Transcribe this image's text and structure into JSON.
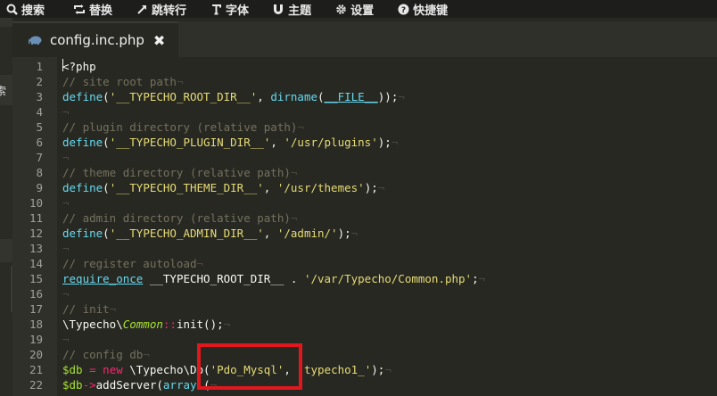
{
  "toolbar": {
    "items": [
      {
        "label": "搜索",
        "icon": "search-icon"
      },
      {
        "label": "替换",
        "icon": "replace-icon"
      },
      {
        "label": "跳转行",
        "icon": "goto-line-icon"
      },
      {
        "label": "字体",
        "icon": "font-icon"
      },
      {
        "label": "主题",
        "icon": "magnet-icon"
      },
      {
        "label": "设置",
        "icon": "gear-icon"
      },
      {
        "label": "快捷键",
        "icon": "help-icon"
      }
    ]
  },
  "sidebar": {
    "label": "索"
  },
  "tab": {
    "filename": "config.inc.php",
    "close": "✖"
  },
  "lines": [
    [
      [
        "plain",
        "<?php"
      ]
    ],
    [
      [
        "com",
        "// site root path"
      ],
      [
        "invis",
        "¬"
      ]
    ],
    [
      [
        "fn",
        "define"
      ],
      [
        "plain",
        "("
      ],
      [
        "str",
        "'__TYPECHO_ROOT_DIR__'"
      ],
      [
        "plain",
        ", "
      ],
      [
        "fn",
        "dirname"
      ],
      [
        "plain",
        "("
      ],
      [
        "def",
        "__FILE__"
      ],
      [
        "plain",
        "));"
      ],
      [
        "invis",
        "¬"
      ]
    ],
    [
      [
        "invis",
        "¬"
      ]
    ],
    [
      [
        "com",
        "// plugin directory (relative path)"
      ],
      [
        "invis",
        "¬"
      ]
    ],
    [
      [
        "fn",
        "define"
      ],
      [
        "plain",
        "("
      ],
      [
        "str",
        "'__TYPECHO_PLUGIN_DIR__'"
      ],
      [
        "plain",
        ", "
      ],
      [
        "str",
        "'/usr/plugins'"
      ],
      [
        "plain",
        ");"
      ],
      [
        "invis",
        "¬"
      ]
    ],
    [
      [
        "invis",
        "¬"
      ]
    ],
    [
      [
        "com",
        "// theme directory (relative path)"
      ],
      [
        "invis",
        "¬"
      ]
    ],
    [
      [
        "fn",
        "define"
      ],
      [
        "plain",
        "("
      ],
      [
        "str",
        "'__TYPECHO_THEME_DIR__'"
      ],
      [
        "plain",
        ", "
      ],
      [
        "str",
        "'/usr/themes'"
      ],
      [
        "plain",
        ");"
      ],
      [
        "invis",
        "¬"
      ]
    ],
    [
      [
        "invis",
        "¬"
      ]
    ],
    [
      [
        "com",
        "// admin directory (relative path)"
      ],
      [
        "invis",
        "¬"
      ]
    ],
    [
      [
        "fn",
        "define"
      ],
      [
        "plain",
        "("
      ],
      [
        "str",
        "'__TYPECHO_ADMIN_DIR__'"
      ],
      [
        "plain",
        ", "
      ],
      [
        "str",
        "'/admin/'"
      ],
      [
        "plain",
        ");"
      ],
      [
        "invis",
        "¬"
      ]
    ],
    [
      [
        "invis",
        "¬"
      ]
    ],
    [
      [
        "com",
        "// register autoload"
      ],
      [
        "invis",
        "¬"
      ]
    ],
    [
      [
        "fnu",
        "require_once"
      ],
      [
        "plain",
        " __TYPECHO_ROOT_DIR__ . "
      ],
      [
        "str",
        "'/var/Typecho/Common.php'"
      ],
      [
        "plain",
        ";"
      ],
      [
        "invis",
        "¬"
      ]
    ],
    [
      [
        "invis",
        "¬"
      ]
    ],
    [
      [
        "com",
        "// init"
      ],
      [
        "invis",
        "¬"
      ]
    ],
    [
      [
        "plain",
        "\\Typecho\\"
      ],
      [
        "cls",
        "Common"
      ],
      [
        "op",
        "::"
      ],
      [
        "plain",
        "init();"
      ],
      [
        "invis",
        "¬"
      ]
    ],
    [
      [
        "invis",
        "¬"
      ]
    ],
    [
      [
        "com",
        "// config db"
      ],
      [
        "invis",
        "¬"
      ]
    ],
    [
      [
        "var",
        "$db"
      ],
      [
        "plain",
        " "
      ],
      [
        "op",
        "="
      ],
      [
        "plain",
        " "
      ],
      [
        "op",
        "new"
      ],
      [
        "plain",
        " \\Typecho\\Db("
      ],
      [
        "str",
        "'Pdo_Mysql'"
      ],
      [
        "plain",
        ", "
      ],
      [
        "str",
        "'typecho1_'"
      ],
      [
        "plain",
        ");"
      ],
      [
        "invis",
        "¬"
      ]
    ],
    [
      [
        "var",
        "$db"
      ],
      [
        "op",
        "->"
      ],
      [
        "plain",
        "addServer("
      ],
      [
        "fn",
        "array"
      ],
      [
        "plain",
        " ("
      ],
      [
        "invis",
        "¬"
      ]
    ]
  ]
}
